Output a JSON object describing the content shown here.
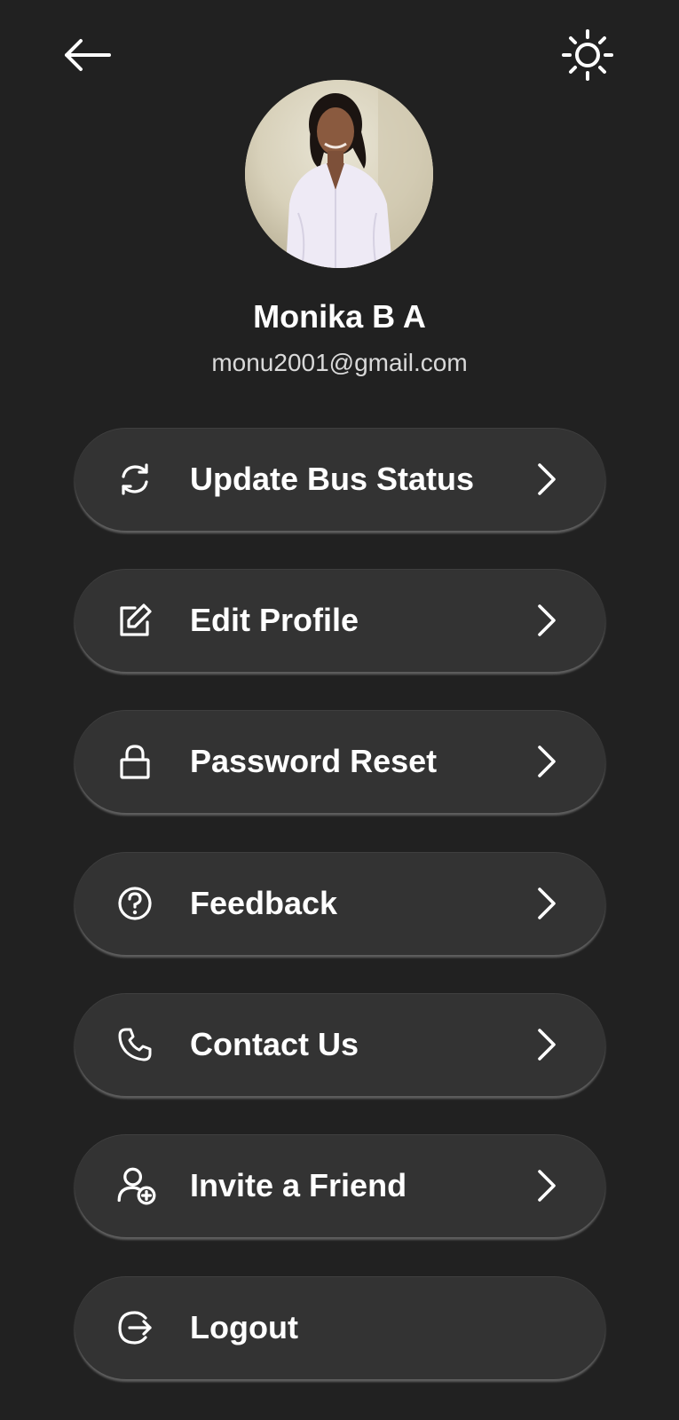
{
  "header": {
    "back_icon": "arrow-left-icon",
    "theme_icon": "sun-icon"
  },
  "profile": {
    "name": "Monika B A",
    "email": "monu2001@gmail.com"
  },
  "menu": {
    "items": [
      {
        "label": "Update Bus Status",
        "icon": "refresh-icon",
        "chevron": true
      },
      {
        "label": "Edit Profile",
        "icon": "edit-icon",
        "chevron": true
      },
      {
        "label": "Password Reset",
        "icon": "lock-icon",
        "chevron": true
      },
      {
        "label": "Feedback",
        "icon": "question-circle-icon",
        "chevron": true
      },
      {
        "label": "Contact Us",
        "icon": "phone-icon",
        "chevron": true
      },
      {
        "label": "Invite a Friend",
        "icon": "add-user-icon",
        "chevron": true
      },
      {
        "label": "Logout",
        "icon": "logout-icon",
        "chevron": false
      }
    ]
  },
  "colors": {
    "background": "#212121",
    "card": "#333333",
    "text": "#ffffff",
    "email_text": "#d9d9d9"
  }
}
